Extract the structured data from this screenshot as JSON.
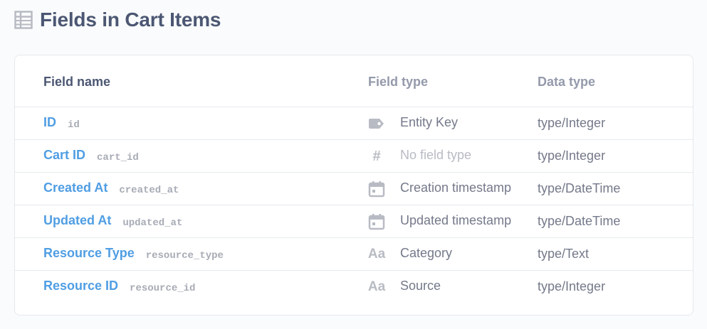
{
  "page": {
    "title": "Fields in Cart Items"
  },
  "table": {
    "headers": {
      "field_name": "Field name",
      "field_type": "Field type",
      "data_type": "Data type"
    },
    "rows": [
      {
        "display_name": "ID",
        "db_name": "id",
        "field_type": "Entity Key",
        "field_type_icon": "key-tag-icon",
        "data_type": "type/Integer",
        "muted": false
      },
      {
        "display_name": "Cart ID",
        "db_name": "cart_id",
        "field_type": "No field type",
        "field_type_icon": "hash-icon",
        "data_type": "type/Integer",
        "muted": true
      },
      {
        "display_name": "Created At",
        "db_name": "created_at",
        "field_type": "Creation timestamp",
        "field_type_icon": "calendar-icon",
        "data_type": "type/DateTime",
        "muted": false
      },
      {
        "display_name": "Updated At",
        "db_name": "updated_at",
        "field_type": "Updated timestamp",
        "field_type_icon": "calendar-icon",
        "data_type": "type/DateTime",
        "muted": false
      },
      {
        "display_name": "Resource Type",
        "db_name": "resource_type",
        "field_type": "Category",
        "field_type_icon": "text-icon",
        "data_type": "type/Text",
        "muted": false
      },
      {
        "display_name": "Resource ID",
        "db_name": "resource_id",
        "field_type": "Source",
        "field_type_icon": "text-icon",
        "data_type": "type/Integer",
        "muted": false
      }
    ]
  },
  "colors": {
    "link": "#509ee3",
    "heading": "#4c5773",
    "muted": "#b8bbc3",
    "border": "#e6e9ed"
  },
  "icons": {
    "text_glyph": "Aa",
    "hash_glyph": "#"
  }
}
